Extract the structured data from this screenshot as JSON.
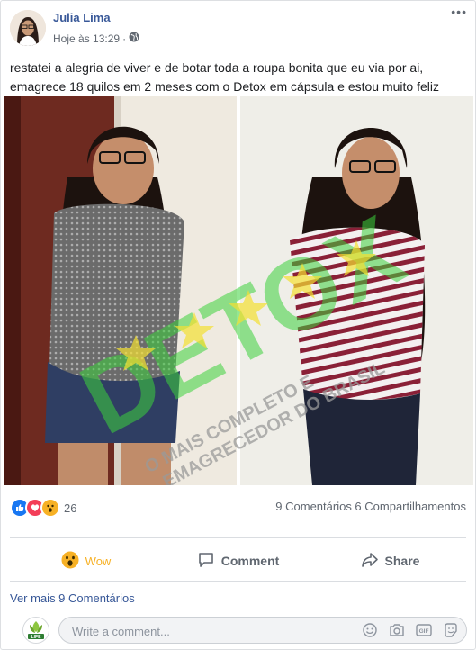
{
  "post": {
    "author": "Julia Lima",
    "time": "Hoje às 13:29",
    "separator": "·",
    "text": "restatei a alegria de viver e de botar toda a roupa bonita que eu via por ai, emagrece 18 quilos em 2 meses com o Detox em cápsula e estou muito feliz",
    "more_icon": "•••"
  },
  "watermark": {
    "big": "DETOX",
    "line1": "O MAIS COMPLETO E",
    "line2": "EMAGRECEDOR DO BRASIL"
  },
  "stats": {
    "reaction_count": "26",
    "comments_shares": "9 Comentários 6 Compartilhamentos"
  },
  "actions": {
    "wow": "Wow",
    "comment": "Comment",
    "share": "Share"
  },
  "see_more": "Ver mais 9 Comentários",
  "composer": {
    "placeholder": "Write a comment...",
    "avatar_text": "LIFE"
  },
  "colors": {
    "link": "#385898",
    "wow": "#f7b125",
    "like": "#1877f2",
    "love": "#f33e58",
    "watermark_green": "#3cd13c",
    "watermark_gray": "#9a9a9a"
  },
  "icons": {
    "globe": "globe-icon",
    "like": "like-reaction-icon",
    "love": "love-reaction-icon",
    "wow": "wow-reaction-icon",
    "comment": "comment-icon",
    "share": "share-icon",
    "emoji": "emoji-icon",
    "camera": "camera-icon",
    "gif": "gif-icon",
    "sticker": "sticker-icon"
  }
}
